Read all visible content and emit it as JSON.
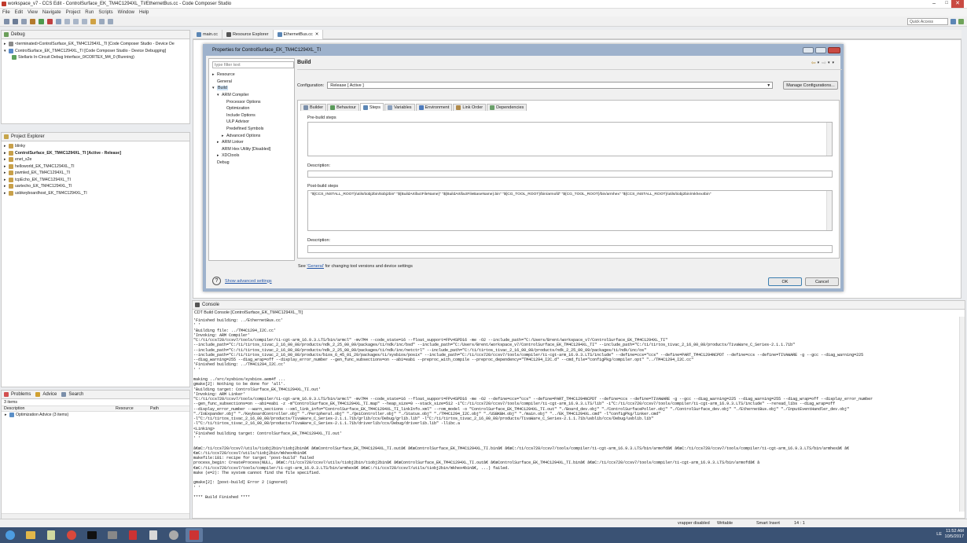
{
  "window": {
    "title": "workspace_v7 - CCS Edit - ControlSurface_EK_TM4C1294XL_TI/EthernetBus.cc - Code Composer Studio"
  },
  "menu": [
    "File",
    "Edit",
    "View",
    "Navigate",
    "Project",
    "Run",
    "Scripts",
    "Window",
    "Help"
  ],
  "quick_access": "Quick Access",
  "debug_view": {
    "tab": "Debug",
    "items": [
      "<terminated>ControlSurface_EK_TM4C1294XL_TI [Code Composer Studio - Device De",
      "ControlSurface_EK_TM4C1294XL_TI [Code Composer Studio - Device Debugging]",
      "Stellaris In-Circuit Debug Interface_0/CORTEX_M4_0 (Running)"
    ]
  },
  "project_explorer": {
    "tab": "Project Explorer",
    "projects": [
      "blinky",
      "ControlSurface_EK_TM4C1294XL_TI [Active - Release]",
      "enet_s2e",
      "helloworld_EK_TM4C1294XL_TI",
      "pwmled_EK_TM4C1294XL_TI",
      "tcpEcho_EK_TM4C1294XL_TI",
      "uartecho_EK_TM4C1294XL_TI",
      "usbkeyboardhost_EK_TM4C1294XL_TI"
    ]
  },
  "problems_view": {
    "tabs": [
      "Problems",
      "Advice",
      "Search"
    ],
    "count": "3 items",
    "columns": [
      "Description",
      "Resource",
      "Path"
    ],
    "rows": [
      "Optimization Advice (3 items)"
    ]
  },
  "editor_tabs": [
    "main.cc",
    "Resource Explorer",
    "EthernetBus.cc"
  ],
  "dialog": {
    "title": "Properties for ControlSurface_EK_TM4C1294XL_TI",
    "filter_placeholder": "type filter text",
    "tree": [
      {
        "label": "Resource",
        "indent": 1,
        "arrow": "▸"
      },
      {
        "label": "General",
        "indent": 1,
        "arrow": ""
      },
      {
        "label": "Build",
        "indent": 1,
        "arrow": "▾",
        "selected": true
      },
      {
        "label": "ARM Compiler",
        "indent": 2,
        "arrow": "▾"
      },
      {
        "label": "Processor Options",
        "indent": 3,
        "arrow": ""
      },
      {
        "label": "Optimization",
        "indent": 3,
        "arrow": ""
      },
      {
        "label": "Include Options",
        "indent": 3,
        "arrow": ""
      },
      {
        "label": "ULP Advisor",
        "indent": 3,
        "arrow": ""
      },
      {
        "label": "Predefined Symbols",
        "indent": 3,
        "arrow": ""
      },
      {
        "label": "Advanced Options",
        "indent": 3,
        "arrow": "▸"
      },
      {
        "label": "ARM Linker",
        "indent": 2,
        "arrow": "▸"
      },
      {
        "label": "ARM Hex Utility  [Disabled]",
        "indent": 2,
        "arrow": ""
      },
      {
        "label": "XDCtools",
        "indent": 2,
        "arrow": "▸"
      },
      {
        "label": "Debug",
        "indent": 1,
        "arrow": ""
      }
    ],
    "page_title": "Build",
    "configuration_label": "Configuration:",
    "configuration_value": "Release  [ Active ]",
    "manage_button": "Manage Configurations...",
    "subtabs": [
      "Builder",
      "Behaviour",
      "Steps",
      "Variables",
      "Environment",
      "Link Order",
      "Dependencies"
    ],
    "prebuild_label": "Pre-build steps",
    "description_label": "Description:",
    "postbuild_label": "Post-build steps",
    "postbuild_value": "\"${CCS_INSTALL_ROOT}/utils/tiobj2bin/tiobj2bin\" \"${BuildArtifactFileName}\" \"${BuildArtifactFileBaseName}.bin\" \"${CG_TOOL_ROOT}/bin/armofd\" \"${CG_TOOL_ROOT}/bin/armhex\" \"${CCS_INSTALL_ROOT}/utils/tiobj2bin/mkhex4bin\"",
    "description2_label": "Description:",
    "see_prefix": "See ",
    "see_link": "'General'",
    "see_suffix": " for changing tool versions and device settings",
    "show_advanced": "Show advanced settings",
    "ok": "OK",
    "cancel": "Cancel"
  },
  "console": {
    "tab": "Console",
    "header": "CDT Build Console [ControlSurface_EK_TM4C1294XL_TI]",
    "lines": [
      "'Finished building: ../EthernetBus.cc'",
      "' '",
      "'Building file: ../TM4C1294_I2C.cc'",
      "'Invoking: ARM Compiler'",
      "\"C:/ti/ccs720/ccsv7/tools/compiler/ti-cgt-arm_16.9.3.LTS/bin/armcl\" -mv7M4 --code_state=16 --float_support=FPv4SPD16 -me -O2 --include_path=\"C:/Users/Brent/workspace_v7/ControlSurface_EK_TM4C1294XL_TI\"",
      "--include_path=\"C:/ti/tirtos_tivac_2_16_00_08/products/ndk_2_25_00_09/packages/ti/ndk/inc/bsd\" --include_path=\"C:/Users/Brent/workspace_v7/ControlSurface_EK_TM4C1294XL_TI\" --include_path=\"C:/ti/tirtos_tivac_2_16_00_08/products/TivaWare_C_Series-2.1.1.71b\"",
      "--include_path=\"C:/ti/tirtos_tivac_2_16_00_08/products/ndk_2_25_00_09/packages/ti/ndk/inc/netctrl\" --include_path=\"C:/ti/tirtos_tivac_2_16_00_08/products/ndk_2_25_00_09/packages/ti/ndk/inc/os\"",
      "--include_path=\"C:/ti/tirtos_tivac_2_16_00_08/products/bios_6_45_01_29/packages/ti/sysbios/posix\" --include_path=\"C:/ti/ccs720/ccsv7/tools/compiler/ti-cgt-arm_16.9.3.LTS/include\" --define=ccs=\"ccs\" --define=PART_TM4C1294NCPDT --define=ccs --define=TIVAWARE -g --gcc --diag_warning=225",
      "--diag_warning=255 --diag_wrap=off --display_error_number --gen_func_subsections=on --abi=eabi --preproc_with_compile --preproc_dependency=\"TM4C1294_I2C.d\" --cmd_file=\"configPkg/compiler.opt\" \"../TM4C1294_I2C.cc\"",
      "'Finished building: ../TM4C1294_I2C.cc'",
      "' '",
      "",
      "making ../src/sysbios/sysbios.aem4f ...",
      "gmake[2]: Nothing to be done for 'all'.",
      "'Building target: ControlSurface_EK_TM4C1294XL_TI.out'",
      "'Invoking: ARM Linker'",
      "\"C:/ti/ccs720/ccsv7/tools/compiler/ti-cgt-arm_16.9.3.LTS/bin/armcl\" -mv7M4 --code_state=16 --float_support=FPv4SPD16 -me -O2 --define=ccs=\"ccs\" --define=PART_TM4C1294NCPDT --define=ccs --define=TIVAWARE -g --gcc --diag_warning=225 --diag_warning=255 --diag_wrap=off --display_error_number",
      "--gen_func_subsections=on --abi=eabi -z -m\"ControlSurface_EK_TM4C1294XL_TI.map\" --heap_size=0 --stack_size=512 -i\"C:/ti/ccs720/ccsv7/tools/compiler/ti-cgt-arm_16.9.3.LTS/lib\" -i\"C:/ti/ccs720/ccsv7/tools/compiler/ti-cgt-arm_16.9.3.LTS/include\" --reread_libs --diag_wrap=off",
      "--display_error_number --warn_sections --xml_link_info=\"ControlSurface_EK_TM4C1294XL_TI_linkInfo.xml\" --rom_model -o \"ControlSurface_EK_TM4C1294XL_TI.out\" \"./Board_dev.obj\" \"./ControlSurfacePoller.obj\" \"./ControlSurface_dev.obj\" \"./EthernetBus.obj\" \"./InputEventHandler_dev.obj\"",
      "\"./IoExpander.obj\" \"./KeyboardController.obj\" \"./Peripheral.obj\" \"./QeiController.obj\" \"./Status.obj\" \"./TM4C1294_I2C.obj\" \"./USBKBH.obj\" \"./main.obj\" \"../EK_TM4C1294XL.cmd\" -l\"configPkg/linker.cmd\"",
      "-l\"C:/ti/tirtos_tivac_2_16_00_08/products/TivaWare_C_Series-2.1.1.71b/grlib/ccs/Debug/grlib.lib\" -l\"C:/ti/tirtos_tivac_2_16_00_08/products/TivaWare_C_Series-2.1.1.71b/usblib/ccs/Debug/usblib.lib\"",
      "-l\"C:/ti/tirtos_tivac_2_16_00_08/products/TivaWare_C_Series-2.1.1.71b/driverlib/ccs/Debug/driverlib.lib\" -llibc.a",
      "<Linking>",
      "'Finished building target: ControlSurface_EK_TM4C1294XL_TI.out'",
      "' '",
      "",
      "â€œC:/ti/ccs720/ccsv7/utils/tiobj2bin/tiobj2binâ€ â€œControlSurface_EK_TM4C1294XL_TI.outâ€ â€œControlSurface_EK_TM4C1294XL_TI.binâ€ â€œC:/ti/ccs720/ccsv7/tools/compiler/ti-cgt-arm_16.9.3.LTS/bin/armofdâ€ â€œC:/ti/ccs720/ccsv7/tools/compiler/ti-cgt-arm_16.9.3.LTS/bin/armhexâ€ â€",
      "€œC:/ti/ccs720/ccsv7/utils/tiobj2bin/mkhex4binâ€",
      "makefile:181: recipe for target 'post-build' failed",
      "process_begin: CreateProcess(NULL, â€œC:/ti/ccs720/ccsv7/utils/tiobj2bin/tiobj2binâ€ â€œControlSurface_EK_TM4C1294XL_TI.outâ€ â€œControlSurface_EK_TM4C1294XL_TI.binâ€ â€œC:/ti/ccs720/ccsv7/tools/compiler/ti-cgt-arm_16.9.3.LTS/bin/armofdâ€ â",
      "€œC:/ti/ccs720/ccsv7/tools/compiler/ti-cgt-arm_16.9.3.LTS/bin/armhexâ€ â€œC:/ti/ccs720/ccsv7/utils/tiobj2bin/mkhex4binâ€, ...) failed.",
      "make (e=2): The system cannot find the file specified.",
      "",
      "gmake[2]: [post-build] Error 2 (ignored)",
      "' '",
      "",
      "**** Build Finished ****"
    ]
  },
  "status_bar": {
    "wrapper": "vrapper disabled",
    "writable": "Writable",
    "insert": "Smart Insert",
    "position": "14 : 1"
  },
  "tray": {
    "lang": "LE",
    "time": "11:52 AM",
    "date": "10/5/2017"
  },
  "colors": {
    "dialog_frame": "#9eb2cc",
    "taskbar": "#3a5274",
    "link": "#2456a8",
    "accent": "#3c7fb1"
  }
}
